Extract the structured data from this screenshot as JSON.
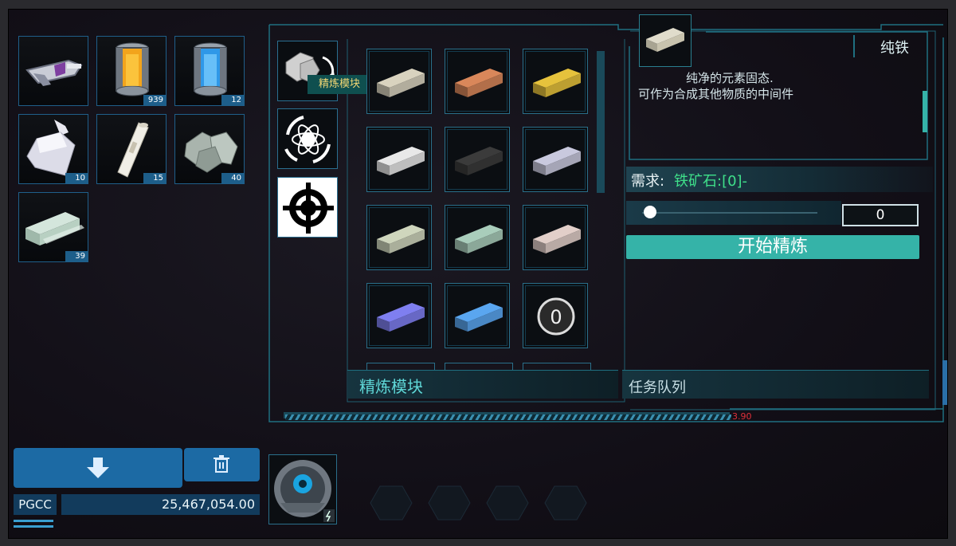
{
  "inventory": [
    {
      "name": "tether-launcher",
      "count": ""
    },
    {
      "name": "orange-canister",
      "count": "939"
    },
    {
      "name": "blue-canister",
      "count": "12"
    },
    {
      "name": "glass-flask",
      "count": "10"
    },
    {
      "name": "white-rod",
      "count": "15"
    },
    {
      "name": "gray-ore",
      "count": "40"
    },
    {
      "name": "pale-green-ingot",
      "count": "39"
    }
  ],
  "modules": {
    "tooltip": "精炼模块"
  },
  "recipes": {
    "section_label": "精炼模块",
    "items": [
      {
        "name": "ingot-cream",
        "color": "#d9d3bf"
      },
      {
        "name": "ingot-copper",
        "color": "#d9875a"
      },
      {
        "name": "ingot-gold",
        "color": "#e6c23c"
      },
      {
        "name": "ingot-silver",
        "color": "#e8e8e8"
      },
      {
        "name": "ingot-dark",
        "color": "#3b3b3b"
      },
      {
        "name": "ingot-lavender",
        "color": "#c9c9de"
      },
      {
        "name": "ingot-sage",
        "color": "#cfd6bd"
      },
      {
        "name": "ingot-mint",
        "color": "#a9cdbb"
      },
      {
        "name": "ingot-rose",
        "color": "#e2cfc9"
      },
      {
        "name": "ingot-violet",
        "color": "#7f7ff0"
      },
      {
        "name": "ingot-sky",
        "color": "#5aa6f0"
      },
      {
        "name": "sphere-zero",
        "label": "0"
      }
    ]
  },
  "detail": {
    "title": "纯铁",
    "description_line1": "纯净的元素固态.",
    "description_line2": "可作为合成其他物质的中间件",
    "requirement_prefix": "需求:",
    "requirement_item": "铁矿石:[0]-",
    "quantity": "0",
    "start_button": "开始精炼",
    "queue_label": "任务队列",
    "progress_value": "3.90"
  },
  "wallet": {
    "currency": "PGCC",
    "amount": "25,467,054.00"
  },
  "colors": {
    "accent": "#35b3a8",
    "frame": "#1f6f80",
    "button": "#1c6aa4",
    "requirement": "#3fe08a"
  }
}
